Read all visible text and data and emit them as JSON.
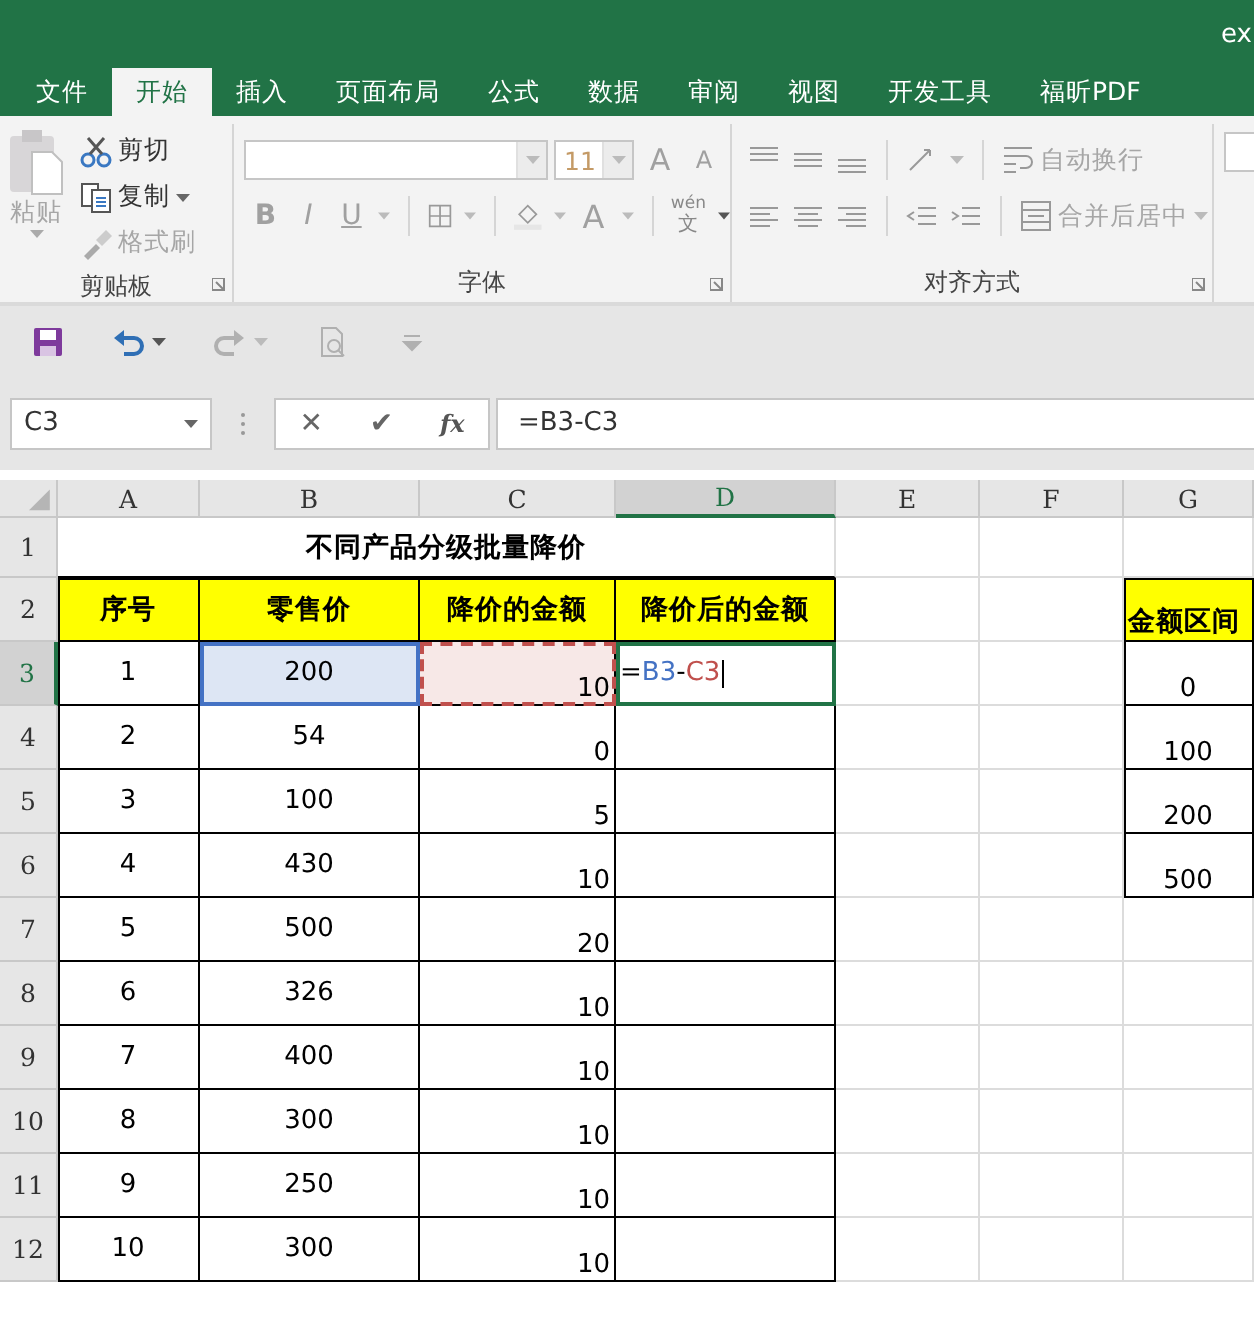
{
  "window": {
    "title": "ex"
  },
  "tabs": [
    {
      "label": "文件",
      "selected": false
    },
    {
      "label": "开始",
      "selected": true
    },
    {
      "label": "插入",
      "selected": false
    },
    {
      "label": "页面布局",
      "selected": false
    },
    {
      "label": "公式",
      "selected": false
    },
    {
      "label": "数据",
      "selected": false
    },
    {
      "label": "审阅",
      "selected": false
    },
    {
      "label": "视图",
      "selected": false
    },
    {
      "label": "开发工具",
      "selected": false
    },
    {
      "label": "福昕PDF",
      "selected": false
    }
  ],
  "ribbon": {
    "clipboard": {
      "paste": {
        "label": "粘贴",
        "disabled": true
      },
      "items": [
        {
          "kind": "cut",
          "label": "剪切",
          "disabled": false
        },
        {
          "kind": "copy",
          "label": "复制",
          "disabled": false
        },
        {
          "kind": "painter",
          "label": "格式刷",
          "disabled": true
        }
      ],
      "label": "剪贴板"
    },
    "font": {
      "font_size": "11",
      "size_buttons": [
        {
          "kind": "grow",
          "label": "A"
        },
        {
          "kind": "shrink",
          "label": "A"
        }
      ],
      "style_buttons": [
        {
          "kind": "bold",
          "label": "B"
        },
        {
          "kind": "italic",
          "label": "I"
        },
        {
          "kind": "underline",
          "label": "U"
        }
      ],
      "font_color": "A",
      "phonetic": {
        "top": "wén",
        "bottom": "文"
      },
      "label": "字体"
    },
    "alignment": {
      "wrap": {
        "label": "自动换行",
        "disabled": true
      },
      "merge": {
        "label": "合并后居中",
        "disabled": true
      },
      "label": "对齐方式"
    }
  },
  "quick_access": [
    {
      "kind": "save",
      "disabled": false
    },
    {
      "kind": "undo",
      "disabled": false
    },
    {
      "kind": "redo",
      "disabled": true
    },
    {
      "kind": "preview",
      "disabled": true
    },
    {
      "kind": "customize",
      "disabled": true
    }
  ],
  "formula_bar": {
    "name_box": "C3",
    "cancel": "✕",
    "enter": "✔",
    "function": "fx",
    "formula": "=B3-C3"
  },
  "sheet": {
    "columns": [
      {
        "label": "A",
        "selected": false
      },
      {
        "label": "B",
        "selected": false
      },
      {
        "label": "C",
        "selected": false
      },
      {
        "label": "D",
        "selected": true
      },
      {
        "label": "E",
        "selected": false
      },
      {
        "label": "F",
        "selected": false
      },
      {
        "label": "G",
        "selected": false
      }
    ],
    "rows": [
      {
        "header": "1",
        "selected": false,
        "kind": "title",
        "title": "不同产品分级批量降价"
      },
      {
        "header": "2",
        "selected": false,
        "kind": "head",
        "seq": "序号",
        "price": "零售价",
        "discount": "降价的金额",
        "after": "降价后的金额",
        "range": "金额区间"
      },
      {
        "header": "3",
        "selected": true,
        "kind": "data",
        "editing": true,
        "seq": "1",
        "price": "200",
        "price_ref": {
          "color": "#4472c4"
        },
        "discount": "10",
        "discount_ref": {
          "color": "#c0504d"
        },
        "after_parts": [
          {
            "text": "=",
            "color": "#000000"
          },
          {
            "text": "B3",
            "color": "#4472c4"
          },
          {
            "text": "-",
            "color": "#000000"
          },
          {
            "text": "C3",
            "color": "#c0504d"
          }
        ],
        "range": "0"
      },
      {
        "header": "4",
        "selected": false,
        "kind": "data",
        "editing": false,
        "seq": "2",
        "price": "54",
        "discount": "0",
        "range": "100"
      },
      {
        "header": "5",
        "selected": false,
        "kind": "data",
        "editing": false,
        "seq": "3",
        "price": "100",
        "discount": "5",
        "range": "200"
      },
      {
        "header": "6",
        "selected": false,
        "kind": "data",
        "editing": false,
        "seq": "4",
        "price": "430",
        "discount": "10",
        "range": "500"
      },
      {
        "header": "7",
        "selected": false,
        "kind": "data",
        "editing": false,
        "seq": "5",
        "price": "500",
        "discount": "20"
      },
      {
        "header": "8",
        "selected": false,
        "kind": "data",
        "editing": false,
        "seq": "6",
        "price": "326",
        "discount": "10"
      },
      {
        "header": "9",
        "selected": false,
        "kind": "data",
        "editing": false,
        "seq": "7",
        "price": "400",
        "discount": "10"
      },
      {
        "header": "10",
        "selected": false,
        "kind": "data",
        "editing": false,
        "seq": "8",
        "price": "300",
        "discount": "10"
      },
      {
        "header": "11",
        "selected": false,
        "kind": "data",
        "editing": false,
        "seq": "9",
        "price": "250",
        "discount": "10"
      },
      {
        "header": "12",
        "selected": false,
        "kind": "data",
        "editing": false,
        "seq": "10",
        "price": "300",
        "discount": "10"
      }
    ]
  }
}
